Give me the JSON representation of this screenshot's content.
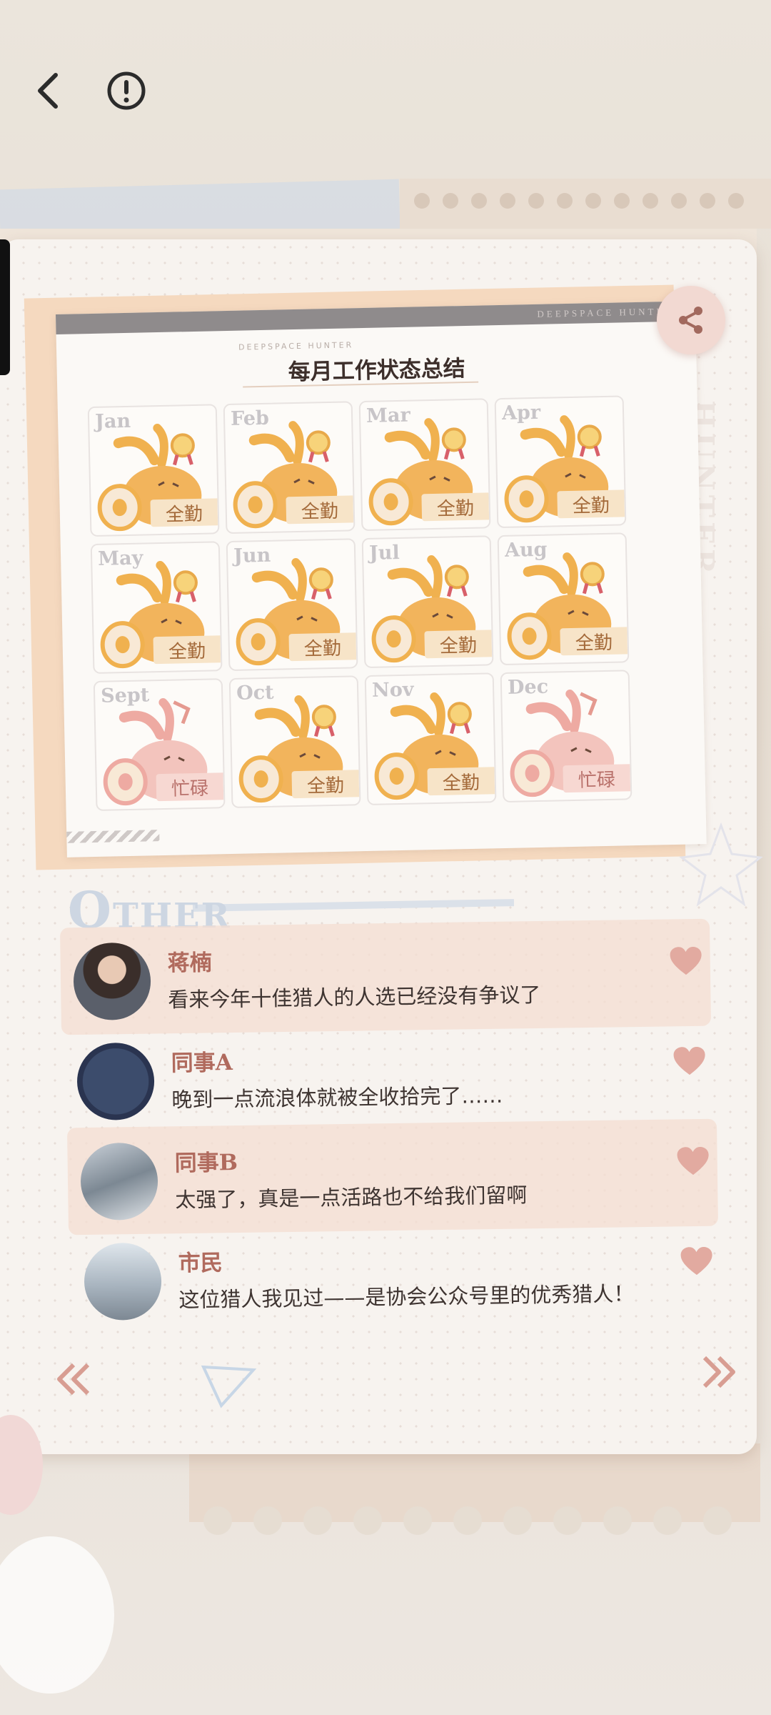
{
  "calendar": {
    "brand": "DEEPSPACE HUNTER",
    "title": "每月工作状态总结",
    "side_text": "HUNTER",
    "months": [
      {
        "month": "Jan",
        "status": "全勤",
        "type": "full"
      },
      {
        "month": "Feb",
        "status": "全勤",
        "type": "full"
      },
      {
        "month": "Mar",
        "status": "全勤",
        "type": "full"
      },
      {
        "month": "Apr",
        "status": "全勤",
        "type": "full"
      },
      {
        "month": "May",
        "status": "全勤",
        "type": "full"
      },
      {
        "month": "Jun",
        "status": "全勤",
        "type": "full"
      },
      {
        "month": "Jul",
        "status": "全勤",
        "type": "full"
      },
      {
        "month": "Aug",
        "status": "全勤",
        "type": "full"
      },
      {
        "month": "Sept",
        "status": "忙碌",
        "type": "busy"
      },
      {
        "month": "Oct",
        "status": "全勤",
        "type": "full"
      },
      {
        "month": "Nov",
        "status": "全勤",
        "type": "full"
      },
      {
        "month": "Dec",
        "status": "忙碌",
        "type": "busy"
      }
    ]
  },
  "other": {
    "title_first": "O",
    "title_rest": "THER"
  },
  "comments": [
    {
      "name": "蒋楠",
      "text": "看来今年十佳猎人的人选已经没有争议了",
      "avatar": "portrait-avatar"
    },
    {
      "name": "同事A",
      "text": "晚到一点流浪体就被全收拾完了……",
      "avatar": "logo-avatar"
    },
    {
      "name": "同事B",
      "text": "太强了，真是一点活路也不给我们留啊",
      "avatar": "photo-avatar"
    },
    {
      "name": "市民",
      "text": "这位猎人我见过——是协会公众号里的优秀猎人！",
      "avatar": "street-avatar"
    }
  ],
  "colors": {
    "accent": "#b06a5d",
    "tag_full": "#f7e4c8",
    "tag_busy": "#f7d8d2",
    "heart": "#e2aaa0"
  },
  "icons": {
    "back": "back-arrow-icon",
    "info": "info-icon",
    "share": "share-icon",
    "prev": "double-chevron-left-icon",
    "next": "double-chevron-right-icon",
    "like": "heart-icon"
  }
}
